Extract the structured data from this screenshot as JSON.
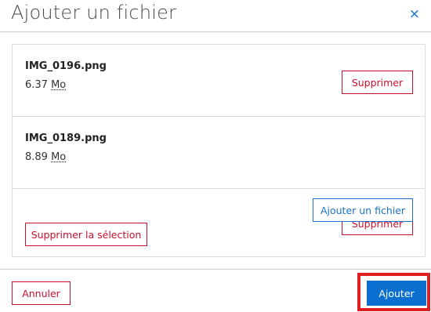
{
  "dialog": {
    "title": "Ajouter un fichier",
    "close_icon": "×"
  },
  "files": [
    {
      "name": "IMG_0196.png",
      "size_value": "6.37",
      "size_unit": "Mo",
      "delete_label": "Supprimer"
    },
    {
      "name": "IMG_0189.png",
      "size_value": "8.89",
      "size_unit": "Mo",
      "delete_label": "Supprimer"
    }
  ],
  "actions": {
    "add_file_label": "Ajouter un fichier",
    "delete_selection_label": "Supprimer la sélection"
  },
  "footer": {
    "cancel_label": "Annuler",
    "submit_label": "Ajouter"
  },
  "colors": {
    "primary": "#0b6fcf",
    "danger": "#c8102e",
    "highlight": "#e02020"
  }
}
